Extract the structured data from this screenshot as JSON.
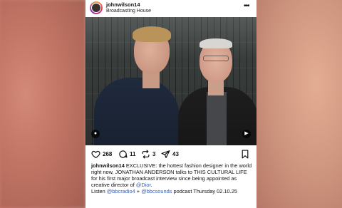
{
  "post": {
    "username": "johnwilson14",
    "location": "Broadcasting House"
  },
  "actions": {
    "likes": "268",
    "comments": "11",
    "reposts": "3",
    "shares": "43"
  },
  "caption": {
    "username": "johnwilson14",
    "text1": " EXCLUSIVE: the hottest fashion designer in the world right now, JONATHAN ANDERSON talks to THIS CULTURAL LIFE for his first major broadcast interview since being appointed as creative director of ",
    "mention_dior": "@Dior",
    "text2": ".",
    "line2_prefix": "Listen ",
    "mention_radio4": "@bbcradio4",
    "plus": " + ",
    "mention_sounds": "@bbcsounds",
    "line2_suffix": " podcast Thursday 02.10.25"
  },
  "colors": {
    "link": "#3a5ea8",
    "text": "#111111"
  },
  "icons": {
    "more": "more-options-icon",
    "heart": "heart-icon",
    "comment": "comment-icon",
    "repost": "repost-icon",
    "share": "share-icon",
    "bookmark": "bookmark-icon",
    "tag": "user-tag-icon",
    "audio": "audio-icon"
  }
}
